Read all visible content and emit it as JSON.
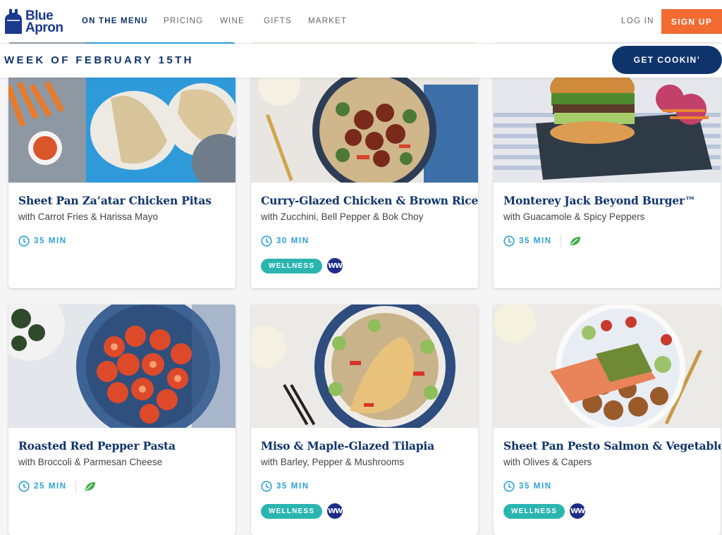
{
  "brand": {
    "logo_line1": "Blue",
    "logo_line2": "Apron",
    "logo_icon": "apron-icon",
    "color": "#0f346c"
  },
  "nav": {
    "items": [
      {
        "label": "ON THE MENU",
        "active": true
      },
      {
        "label": "PRICING"
      },
      {
        "label": "WINE"
      },
      {
        "label": "GIFTS"
      },
      {
        "label": "MARKET"
      }
    ],
    "login": "LOG IN",
    "signup": "SIGN UP",
    "signup_color": "#f26b31"
  },
  "week": {
    "title": "WEEK OF FEBRUARY 15TH",
    "cta": "GET COOKIN’"
  },
  "recipes": [
    {
      "title": "Sheet Pan Za’atar Chicken Pitas",
      "subtitle": "with Carrot Fries & Harissa Mayo",
      "time": "35 MIN",
      "vegetarian": false,
      "wellness": false
    },
    {
      "title": "Curry-Glazed Chicken & Brown Rice",
      "subtitle": "with Zucchini, Bell Pepper & Bok Choy",
      "time": "30 MIN",
      "vegetarian": false,
      "wellness": true
    },
    {
      "title": "Monterey Jack Beyond Burger™",
      "subtitle": "with Guacamole & Spicy Peppers",
      "time": "35 MIN",
      "vegetarian": true,
      "wellness": false
    },
    {
      "title": "Roasted Red Pepper Pasta",
      "subtitle": "with Broccoli & Parmesan Cheese",
      "time": "25 MIN",
      "vegetarian": true,
      "wellness": false
    },
    {
      "title": "Miso & Maple-Glazed Tilapia",
      "subtitle": "with Barley, Pepper & Mushrooms",
      "time": "35 MIN",
      "vegetarian": false,
      "wellness": true
    },
    {
      "title": "Sheet Pan Pesto Salmon & Vegetables",
      "subtitle": "with Olives & Capers",
      "time": "35 MIN",
      "vegetarian": false,
      "wellness": true
    }
  ],
  "badges": {
    "wellness_label": "WELLNESS",
    "ww_label": "WW",
    "wellness_color": "#2bb5b1",
    "time_color": "#2d9fd9"
  }
}
